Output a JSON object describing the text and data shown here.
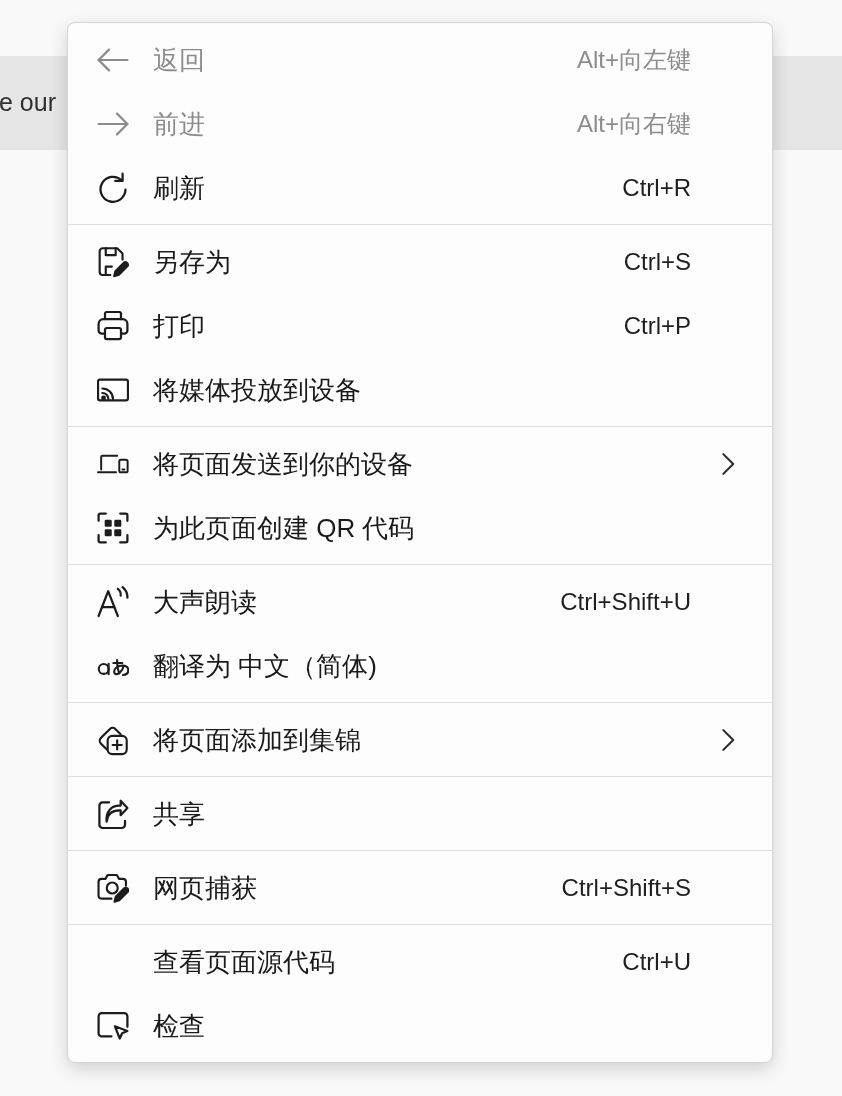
{
  "page": {
    "banner": {
      "text": "e our"
    }
  },
  "context_menu": {
    "groups": [
      {
        "items": [
          {
            "label": "返回",
            "shortcut": "Alt+向左键",
            "disabled": true,
            "has_submenu": false
          },
          {
            "label": "前进",
            "shortcut": "Alt+向右键",
            "disabled": true,
            "has_submenu": false
          },
          {
            "label": "刷新",
            "shortcut": "Ctrl+R",
            "disabled": false,
            "has_submenu": false
          }
        ]
      },
      {
        "items": [
          {
            "label": "另存为",
            "shortcut": "Ctrl+S",
            "disabled": false,
            "has_submenu": false
          },
          {
            "label": "打印",
            "shortcut": "Ctrl+P",
            "disabled": false,
            "has_submenu": false
          },
          {
            "label": "将媒体投放到设备",
            "disabled": false,
            "has_submenu": false
          }
        ]
      },
      {
        "items": [
          {
            "label": "将页面发送到你的设备",
            "disabled": false,
            "has_submenu": true
          },
          {
            "label": "为此页面创建 QR 代码",
            "disabled": false,
            "has_submenu": false
          }
        ]
      },
      {
        "items": [
          {
            "label": "大声朗读",
            "shortcut": "Ctrl+Shift+U",
            "disabled": false,
            "has_submenu": false
          },
          {
            "label": "翻译为 中文（简体)",
            "disabled": false,
            "has_submenu": false
          }
        ]
      },
      {
        "items": [
          {
            "label": "将页面添加到集锦",
            "disabled": false,
            "has_submenu": true
          }
        ]
      },
      {
        "items": [
          {
            "label": "共享",
            "disabled": false,
            "has_submenu": false
          }
        ]
      },
      {
        "items": [
          {
            "label": "网页捕获",
            "shortcut": "Ctrl+Shift+S",
            "disabled": false,
            "has_submenu": false
          }
        ]
      },
      {
        "items": [
          {
            "label": "查看页面源代码",
            "shortcut": "Ctrl+U",
            "disabled": false,
            "has_submenu": false
          },
          {
            "label": "检查",
            "disabled": false,
            "has_submenu": false
          }
        ]
      }
    ]
  }
}
